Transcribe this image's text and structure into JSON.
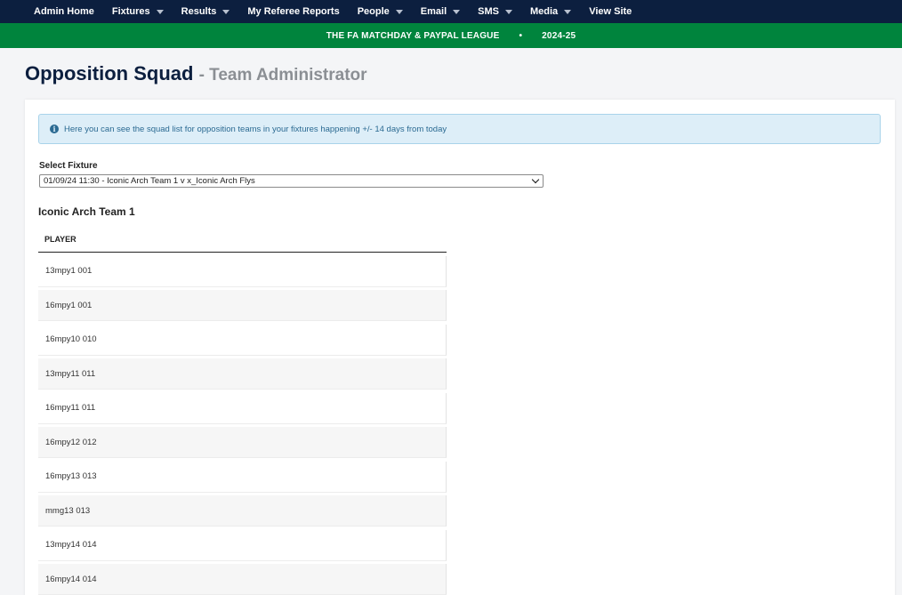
{
  "nav": {
    "items": [
      {
        "label": "Admin Home",
        "dropdown": false
      },
      {
        "label": "Fixtures",
        "dropdown": true
      },
      {
        "label": "Results",
        "dropdown": true
      },
      {
        "label": "My Referee Reports",
        "dropdown": false
      },
      {
        "label": "People",
        "dropdown": true
      },
      {
        "label": "Email",
        "dropdown": true
      },
      {
        "label": "SMS",
        "dropdown": true
      },
      {
        "label": "Media",
        "dropdown": true
      },
      {
        "label": "View Site",
        "dropdown": false
      }
    ]
  },
  "league": {
    "name": "THE FA MATCHDAY & PAYPAL LEAGUE",
    "separator": "•",
    "season": "2024-25"
  },
  "page": {
    "title": "Opposition Squad",
    "subtitle": "- Team Administrator"
  },
  "info": {
    "text": "Here you can see the squad list for opposition teams in your fixtures happening +/- 14 days from today"
  },
  "fixture": {
    "label": "Select Fixture",
    "selected": "01/09/24 11:30 - Iconic Arch Team 1 v x_Iconic Arch Flys"
  },
  "squad": {
    "team": "Iconic Arch Team 1",
    "column": "PLAYER",
    "players": [
      "13mpy1 001",
      "16mpy1 001",
      "16mpy10 010",
      "13mpy11 011",
      "16mpy11 011",
      "16mpy12 012",
      "16mpy13 013",
      "mmg13 013",
      "13mpy14 014",
      "16mpy14 014"
    ]
  },
  "colors": {
    "nav_bg": "#0c1f3f",
    "league_bg": "#00843d",
    "info_bg": "#ddeef8",
    "info_text": "#2b6a92"
  }
}
